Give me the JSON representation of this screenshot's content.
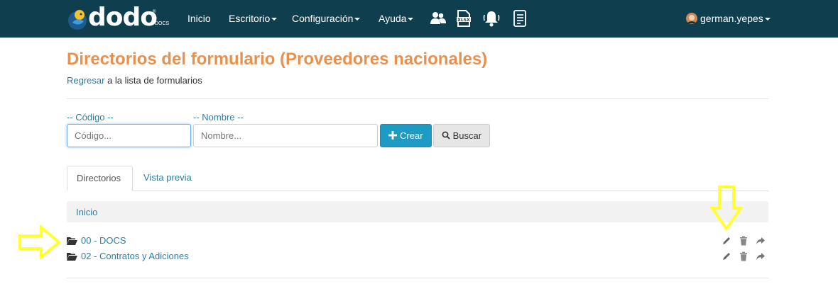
{
  "navbar": {
    "logo_text": "dodo",
    "logo_sub": "DOCS",
    "logo_reg": "®",
    "menu": [
      {
        "label": "Inicio",
        "dropdown": false
      },
      {
        "label": "Escritorio",
        "dropdown": true
      },
      {
        "label": "Configuración",
        "dropdown": true
      },
      {
        "label": "Ayuda",
        "dropdown": true
      }
    ],
    "icons": [
      "users-icon",
      "xlsx-file-icon",
      "bell-icon",
      "document-list-icon"
    ],
    "user": "german.yepes",
    "bg_color": "#0f3f4f"
  },
  "page": {
    "title": "Directorios del formulario (Proveedores nacionales)",
    "back_link": "Regresar",
    "back_text": " a la lista de formularios",
    "title_color": "#e8914e",
    "link_color": "#2a7fa8"
  },
  "filters": {
    "code_label": "-- Código --",
    "code_placeholder": "Código...",
    "name_label": "-- Nombre --",
    "name_placeholder": "Nombre...",
    "create_label": "Crear",
    "search_label": "Buscar"
  },
  "tabs": [
    {
      "label": "Directorios",
      "active": true
    },
    {
      "label": "Vista previa",
      "active": false
    }
  ],
  "breadcrumb": {
    "label": "Inicio"
  },
  "directories": [
    {
      "label": "00 - DOCS"
    },
    {
      "label": "02 - Contratos y Adiciones"
    }
  ],
  "annotations": {
    "arrow_color": "#ffff33"
  }
}
